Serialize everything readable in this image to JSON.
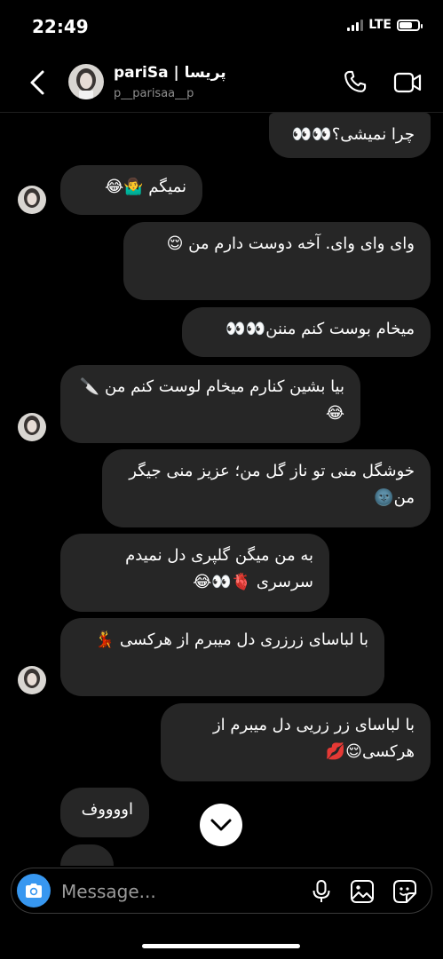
{
  "status": {
    "time": "22:49",
    "network": "LTE",
    "battery_level": 0.75
  },
  "header": {
    "name": "pariSa | پریسا",
    "username": "p__parisaa__p",
    "icons": [
      "chevron-left-icon",
      "phone-icon",
      "video-icon"
    ]
  },
  "messages": [
    {
      "side": "sent",
      "text": "چرا نمیشی؟👀👀"
    },
    {
      "side": "received",
      "text": "نمیگم 🤷‍♂️😂"
    },
    {
      "side": "sent",
      "text": "وای وای وای. آخه دوست دارم من 😌"
    },
    {
      "side": "sent",
      "text": "میخام بوست کنم مننن👀👀"
    },
    {
      "side": "received",
      "text": "بیا بشین کنارم میخام لوست کنم من 🔪😂"
    },
    {
      "side": "sent",
      "text": "خوشگل منی تو ناز گل من؛ عزیز منی جیگر من🌚"
    },
    {
      "side": "received",
      "text": "به من میگن گلپری دل نمیدم سرسری 🫀👀😂"
    },
    {
      "side": "received",
      "text": "با لباسای زرزری دل میبرم از هرکسی 💃"
    },
    {
      "side": "sent",
      "text": "با لباسای زر زریی دل میبرم از هرکسی😌💋"
    },
    {
      "side": "received",
      "text": "اووووف"
    }
  ],
  "composer": {
    "placeholder": "Message..."
  },
  "colors": {
    "bubble": "#262626",
    "accent": "#3797f0",
    "background": "#000000"
  }
}
